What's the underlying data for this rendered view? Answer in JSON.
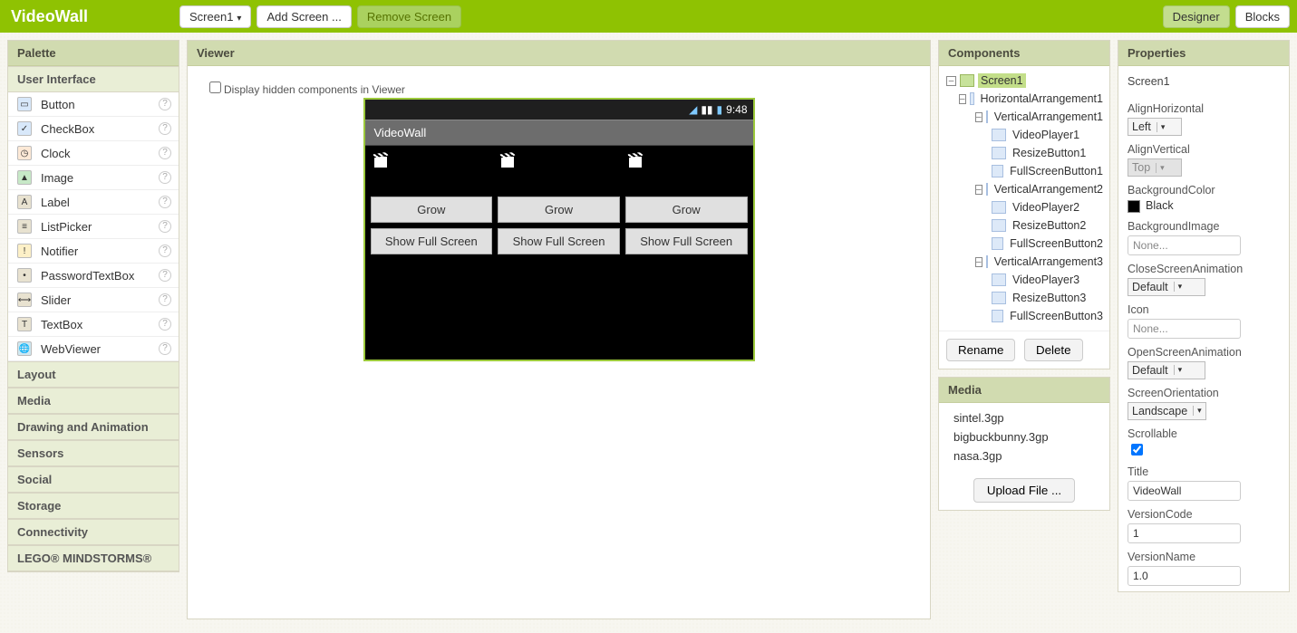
{
  "topbar": {
    "title": "VideoWall",
    "screen_sel": "Screen1",
    "add_screen": "Add Screen ...",
    "remove_screen": "Remove Screen",
    "designer": "Designer",
    "blocks": "Blocks"
  },
  "palette": {
    "header": "Palette",
    "group_open": "User Interface",
    "items": [
      "Button",
      "CheckBox",
      "Clock",
      "Image",
      "Label",
      "ListPicker",
      "Notifier",
      "PasswordTextBox",
      "Slider",
      "TextBox",
      "WebViewer"
    ],
    "groups": [
      "Layout",
      "Media",
      "Drawing and Animation",
      "Sensors",
      "Social",
      "Storage",
      "Connectivity",
      "LEGO® MINDSTORMS®"
    ]
  },
  "viewer": {
    "header": "Viewer",
    "hidden_label": "Display hidden components in Viewer",
    "status_time": "9:48",
    "app_title": "VideoWall",
    "grow": "Grow",
    "full": "Show Full Screen"
  },
  "components": {
    "header": "Components",
    "tree": {
      "root": "Screen1",
      "h": "HorizontalArrangement1",
      "v1": "VerticalArrangement1",
      "v1a": "VideoPlayer1",
      "v1b": "ResizeButton1",
      "v1c": "FullScreenButton1",
      "v2": "VerticalArrangement2",
      "v2a": "VideoPlayer2",
      "v2b": "ResizeButton2",
      "v2c": "FullScreenButton2",
      "v3": "VerticalArrangement3",
      "v3a": "VideoPlayer3",
      "v3b": "ResizeButton3",
      "v3c": "FullScreenButton3"
    },
    "rename": "Rename",
    "delete": "Delete",
    "media_header": "Media",
    "media": [
      "sintel.3gp",
      "bigbuckbunny.3gp",
      "nasa.3gp"
    ],
    "upload": "Upload File ..."
  },
  "props": {
    "header": "Properties",
    "target": "Screen1",
    "alignH_label": "AlignHorizontal",
    "alignH": "Left",
    "alignV_label": "AlignVertical",
    "alignV": "Top",
    "bgcolor_label": "BackgroundColor",
    "bgcolor": "Black",
    "bgimg_label": "BackgroundImage",
    "bgimg": "None...",
    "closeanim_label": "CloseScreenAnimation",
    "closeanim": "Default",
    "icon_label": "Icon",
    "icon": "None...",
    "openanim_label": "OpenScreenAnimation",
    "openanim": "Default",
    "orient_label": "ScreenOrientation",
    "orient": "Landscape",
    "scroll_label": "Scrollable",
    "title_label": "Title",
    "title": "VideoWall",
    "vcode_label": "VersionCode",
    "vcode": "1",
    "vname_label": "VersionName",
    "vname": "1.0"
  }
}
